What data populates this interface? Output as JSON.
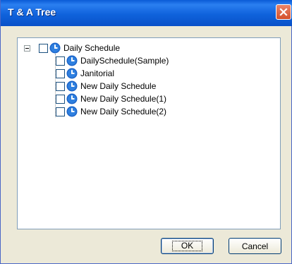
{
  "window": {
    "title": "T & A Tree",
    "close_icon": "close-icon"
  },
  "tree": {
    "root": {
      "label": "Daily Schedule",
      "expanded": true,
      "checked": false,
      "icon": "clock-icon"
    },
    "children": [
      {
        "label": "DailySchedule(Sample)",
        "checked": false,
        "icon": "clock-icon"
      },
      {
        "label": "Janitorial",
        "checked": false,
        "icon": "clock-icon"
      },
      {
        "label": "New Daily Schedule",
        "checked": false,
        "icon": "clock-icon"
      },
      {
        "label": "New Daily Schedule(1)",
        "checked": false,
        "icon": "clock-icon"
      },
      {
        "label": "New Daily Schedule(2)",
        "checked": false,
        "icon": "clock-icon"
      }
    ]
  },
  "buttons": {
    "ok_label": "OK",
    "cancel_label": "Cancel"
  },
  "colors": {
    "titlebar": "#0a5bd6",
    "dialog_bg": "#ece9d8",
    "close_button": "#d5502a",
    "clock_icon": "#1c64c8"
  }
}
